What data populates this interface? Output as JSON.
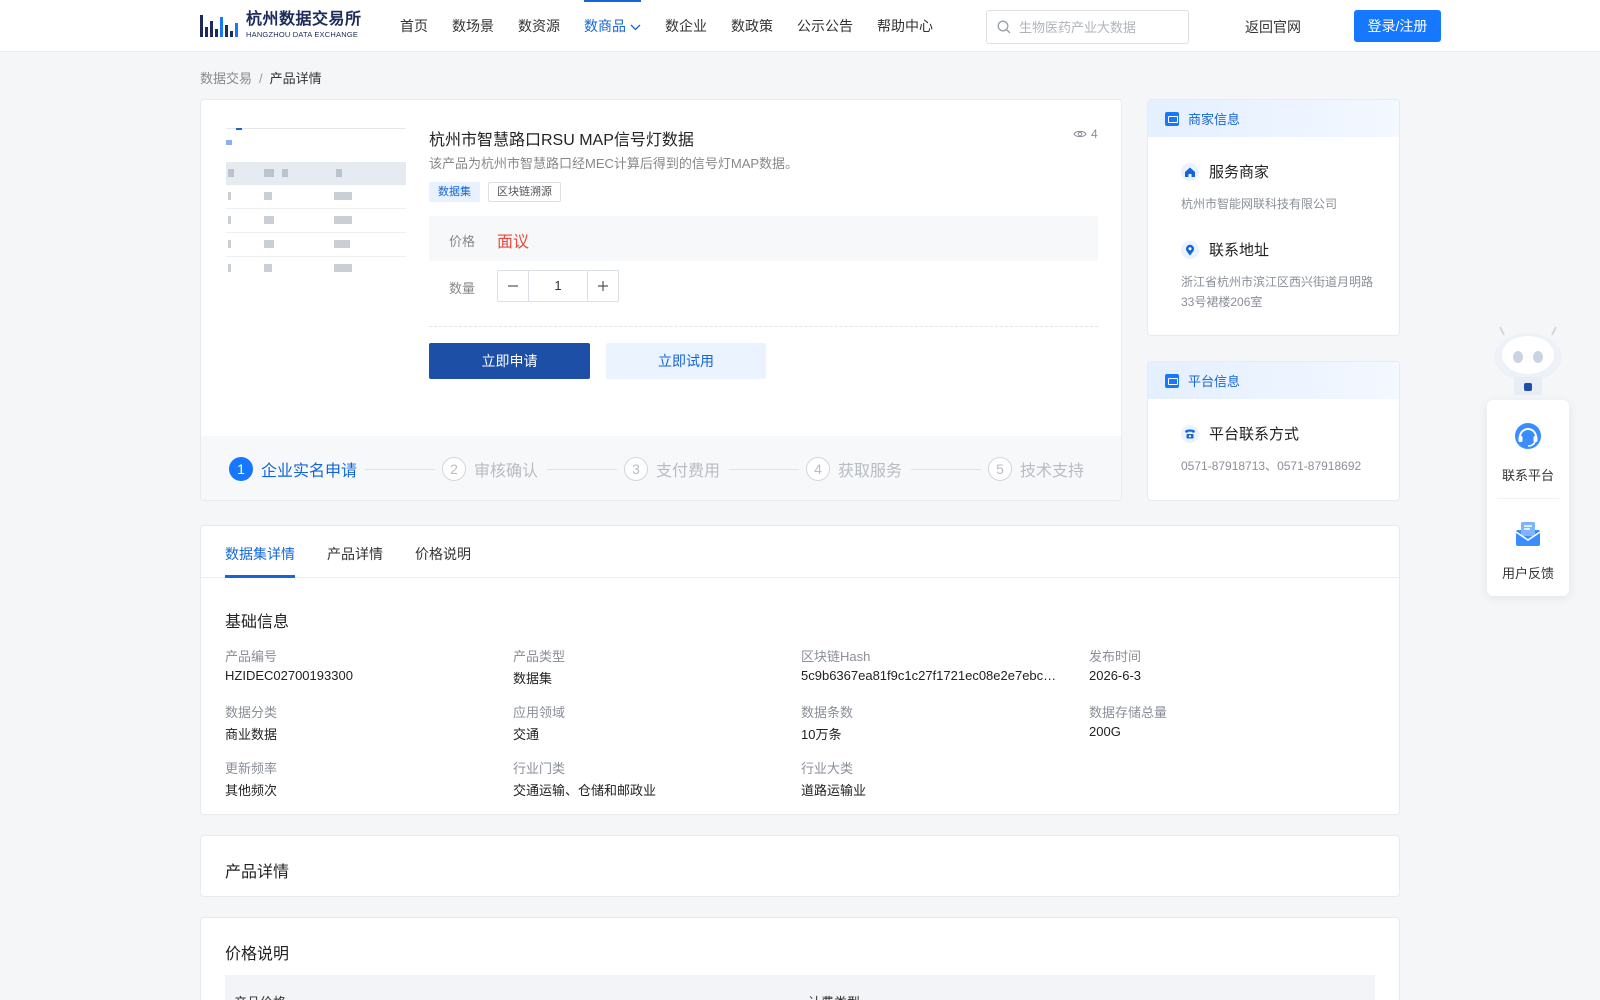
{
  "header": {
    "logo_cn": "杭州数据交易所",
    "logo_en": "HANGZHOU DATA EXCHANGE",
    "nav": [
      "首页",
      "数场景",
      "数资源",
      "数商品",
      "数企业",
      "数政策",
      "公示公告",
      "帮助中心"
    ],
    "active_nav": "数商品",
    "search_placeholder": "生物医药产业大数据",
    "back_link": "返回官网",
    "login_label": "登录/注册"
  },
  "breadcrumb": {
    "root": "数据交易",
    "separator": "/",
    "current": "产品详情"
  },
  "product": {
    "title": "杭州市智慧路口RSU MAP信号灯数据",
    "views": "4",
    "description": "该产品为杭州市智慧路口经MEC计算后得到的信号灯MAP数据。",
    "tags": [
      "数据集",
      "区块链溯源"
    ],
    "price_label": "价格",
    "price_value": "面议",
    "qty_label": "数量",
    "qty_value": "1",
    "apply_label": "立即申请",
    "trial_label": "立即试用"
  },
  "steps": [
    {
      "num": "1",
      "label": "企业实名申请"
    },
    {
      "num": "2",
      "label": "审核确认"
    },
    {
      "num": "3",
      "label": "支付费用"
    },
    {
      "num": "4",
      "label": "获取服务"
    },
    {
      "num": "5",
      "label": "技术支持"
    }
  ],
  "merchant": {
    "head": "商家信息",
    "service_title": "服务商家",
    "service_value": "杭州市智能网联科技有限公司",
    "address_title": "联系地址",
    "address_value": "浙江省杭州市滨江区西兴街道月明路33号裙楼206室"
  },
  "platform": {
    "head": "平台信息",
    "contact_title": "平台联系方式",
    "contact_value": "0571-87918713、0571-87918692"
  },
  "float": {
    "contact": "联系平台",
    "feedback": "用户反馈"
  },
  "details": {
    "tabs": [
      "数据集详情",
      "产品详情",
      "价格说明"
    ],
    "basic_title": "基础信息",
    "fields": [
      {
        "label": "产品编号",
        "value": "HZIDEC02700193300"
      },
      {
        "label": "产品类型",
        "value": "数据集"
      },
      {
        "label": "区块链Hash",
        "value": "5c9b6367ea81f9c1c27f1721ec08e2e7ebc…"
      },
      {
        "label": "发布时间",
        "value": "2026-6-3"
      },
      {
        "label": "数据分类",
        "value": "商业数据"
      },
      {
        "label": "应用领域",
        "value": "交通"
      },
      {
        "label": "数据条数",
        "value": "10万条"
      },
      {
        "label": "数据存储总量",
        "value": "200G"
      },
      {
        "label": "更新频率",
        "value": "其他频次"
      },
      {
        "label": "行业门类",
        "value": "交通运输、仓储和邮政业"
      },
      {
        "label": "行业大类",
        "value": "道路运输业"
      }
    ],
    "product_detail_title": "产品详情",
    "price_title": "价格说明",
    "price_table_headers": [
      "产品价格",
      "计费类型"
    ]
  },
  "colors": {
    "accent": "#1466d6",
    "primary_button": "#1d4fa6",
    "price": "#e8483b"
  }
}
